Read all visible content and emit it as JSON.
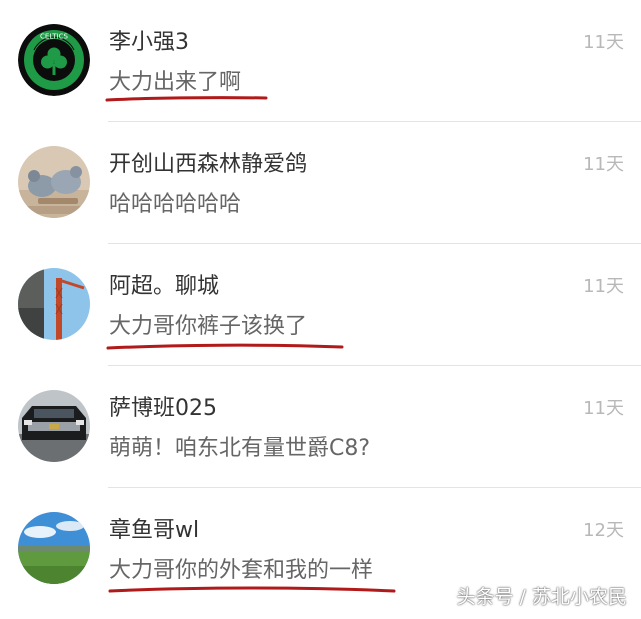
{
  "conversations": [
    {
      "name": "李小强3",
      "time": "11天",
      "message": "大力出来了啊",
      "avatar_icon": "celtics-logo-icon",
      "underlined": true
    },
    {
      "name": "开创山西森林静爱鸽",
      "time": "11天",
      "message": "哈哈哈哈哈哈",
      "avatar_icon": "pigeons-photo-icon",
      "underlined": false
    },
    {
      "name": "阿超。聊城",
      "time": "11天",
      "message": "大力哥你裤子该换了",
      "avatar_icon": "crane-photo-icon",
      "underlined": true
    },
    {
      "name": "萨博班025",
      "time": "11天",
      "message": "萌萌！咱东北有量世爵C8?",
      "avatar_icon": "suv-photo-icon",
      "underlined": false
    },
    {
      "name": "章鱼哥wl",
      "time": "12天",
      "message": "大力哥你的外套和我的一样",
      "avatar_icon": "landscape-photo-icon",
      "underlined": true
    }
  ],
  "watermark": "头条号 / 苏北小农民",
  "colors": {
    "underline": "#b01a1a",
    "time": "#b8b8b8",
    "divider": "#e3e3e3"
  }
}
